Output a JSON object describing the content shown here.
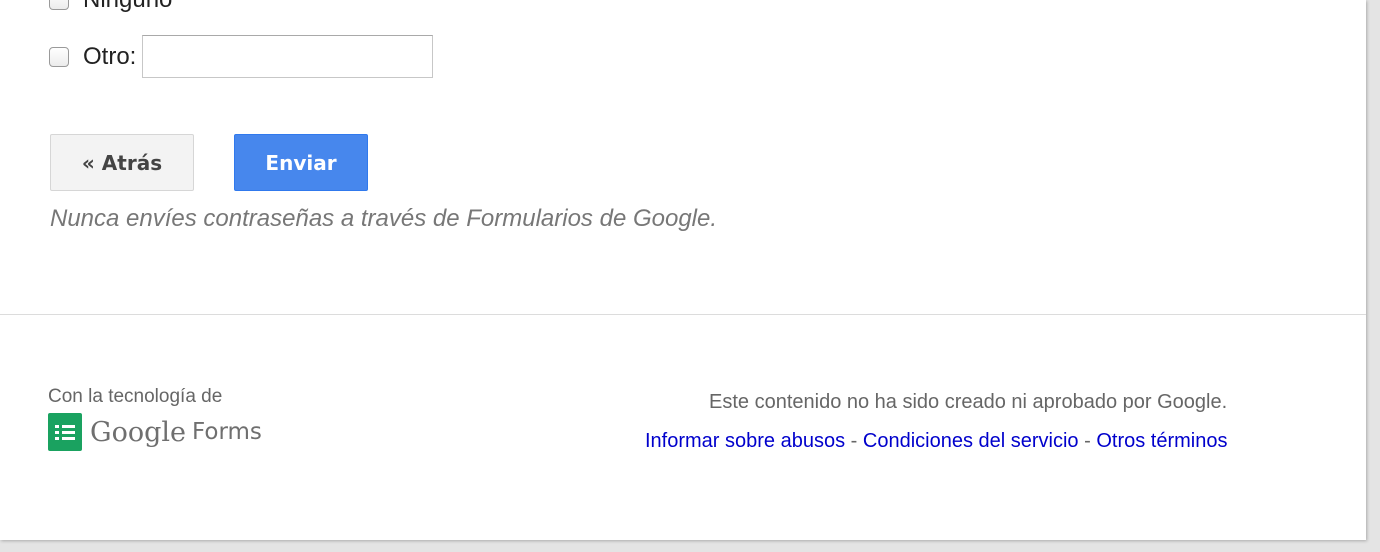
{
  "options": {
    "none_label": "Ninguno",
    "other_label": "Otro:",
    "other_value": ""
  },
  "buttons": {
    "back_label": "« Atrás",
    "submit_label": "Enviar"
  },
  "warning_text": "Nunca envíes contraseñas a través de Formularios de Google.",
  "footer": {
    "powered_by": "Con la tecnología de",
    "brand_google": "Google",
    "brand_forms": "Forms",
    "disclaimer": "Este contenido no ha sido creado ni aprobado por Google.",
    "links": {
      "report_abuse": "Informar sobre abusos",
      "terms_of_service": "Condiciones del servicio",
      "other_terms": "Otros términos",
      "separator": " - "
    }
  },
  "colors": {
    "submit_button": "#4787ed",
    "link": "#0000cc",
    "forms_icon": "#1aa260"
  }
}
